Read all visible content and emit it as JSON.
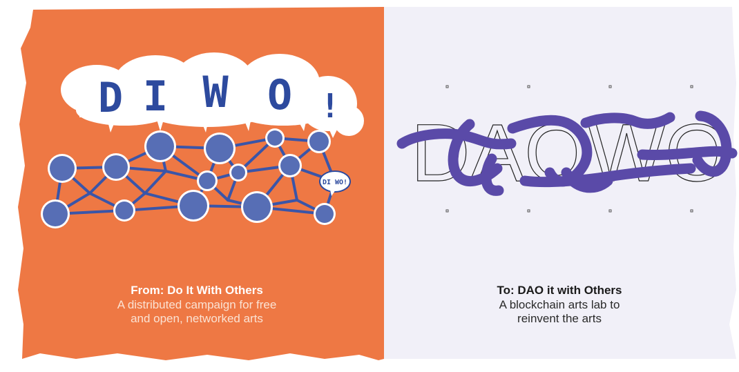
{
  "left_panel": {
    "bg_color": "#ee7844",
    "logo_letters": [
      "D",
      "I",
      "W",
      "O",
      "!"
    ],
    "logo_color": "#2d4a9e",
    "network_color": "#3a55a8",
    "small_bubble_text": "DI WO!",
    "caption_title": "From: Do It With Others",
    "caption_lines": [
      "A distributed campaign for free",
      "and open, networked arts"
    ]
  },
  "right_panel": {
    "bg_color": "#f1f0f8",
    "outline_text": "DAOWO",
    "brush_color": "#5a4aa8",
    "caption_title": "To: DAO it with Others",
    "caption_lines": [
      "A blockchain arts lab to",
      "reinvent the arts"
    ]
  }
}
